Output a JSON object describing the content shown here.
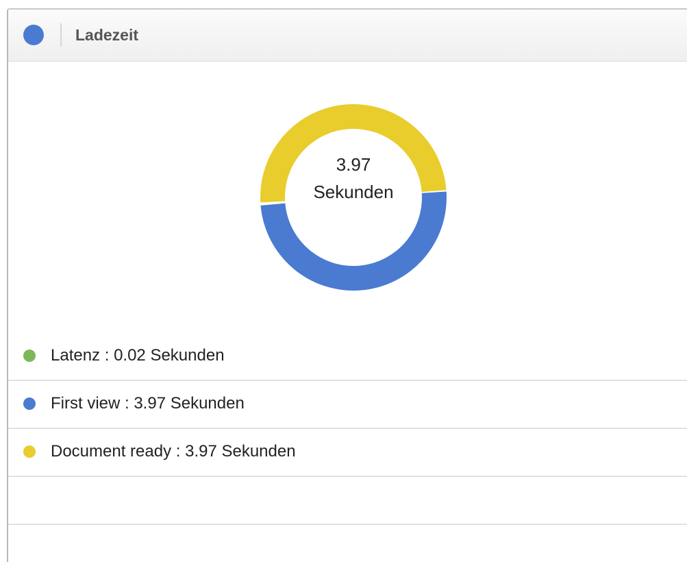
{
  "panel": {
    "title": "Ladezeit",
    "accent_color": "#4a7bd0"
  },
  "chart_data": {
    "type": "pie",
    "donut": true,
    "center_value": "3.97",
    "center_unit": "Sekunden",
    "slices": [
      {
        "label": "Latenz",
        "value": 0.02,
        "color": "#7db75b"
      },
      {
        "label": "First view",
        "value": 3.97,
        "color": "#4a7bd0"
      },
      {
        "label": "Document ready",
        "value": 3.97,
        "color": "#e8cd2c"
      }
    ],
    "legend": [
      {
        "text": "Latenz : 0.02 Sekunden",
        "color": "#7db75b"
      },
      {
        "text": "First view : 3.97 Sekunden",
        "color": "#4a7bd0"
      },
      {
        "text": "Document ready : 3.97 Sekunden",
        "color": "#e8cd2c"
      },
      {
        "text": "",
        "color": ""
      },
      {
        "text": "",
        "color": ""
      }
    ]
  }
}
